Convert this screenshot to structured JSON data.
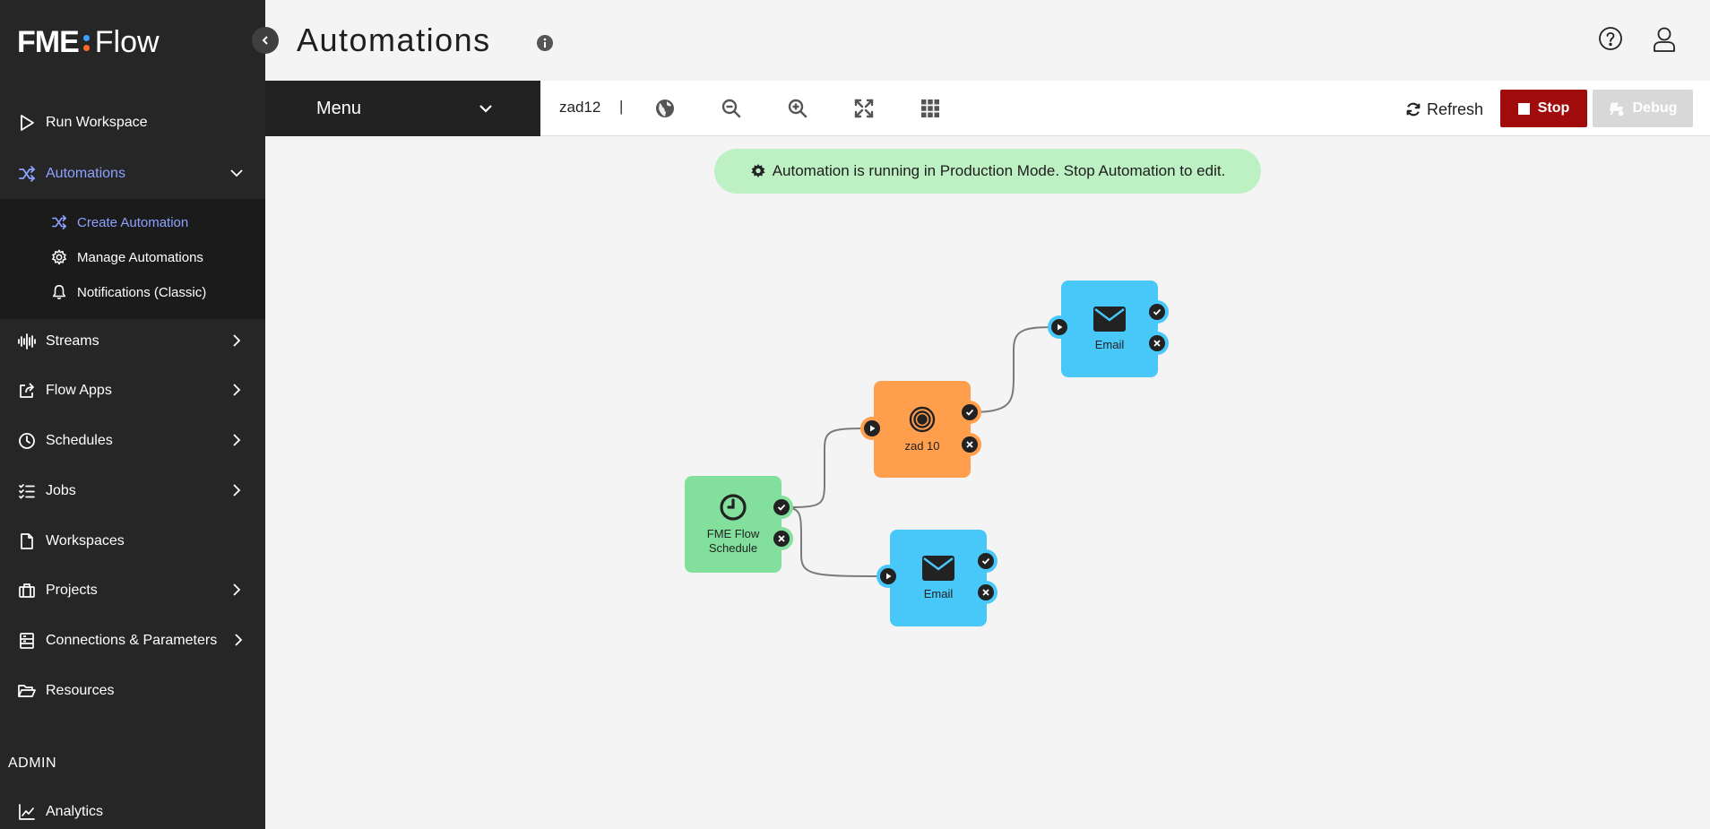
{
  "app": {
    "logo_main": "FME",
    "logo_sub": "Flow",
    "logo_dot_colors": [
      "#3aa0ff",
      "#ff6a2a"
    ]
  },
  "sidebar": {
    "items": [
      {
        "label": "Run Workspace",
        "icon": "play-outline-icon"
      },
      {
        "label": "Automations",
        "icon": "shuffle-icon",
        "active": true,
        "expanded": true
      },
      {
        "label": "Streams",
        "icon": "waveform-icon"
      },
      {
        "label": "Flow Apps",
        "icon": "share-icon"
      },
      {
        "label": "Schedules",
        "icon": "clock-icon"
      },
      {
        "label": "Jobs",
        "icon": "list-check-icon"
      },
      {
        "label": "Workspaces",
        "icon": "file-icon"
      },
      {
        "label": "Projects",
        "icon": "briefcase-icon"
      },
      {
        "label": "Connections & Parameters",
        "icon": "database-icon"
      },
      {
        "label": "Resources",
        "icon": "folder-open-icon"
      }
    ],
    "submenu": [
      {
        "label": "Create Automation",
        "icon": "shuffle-icon",
        "active": true
      },
      {
        "label": "Manage Automations",
        "icon": "gear-icon"
      },
      {
        "label": "Notifications (Classic)",
        "icon": "bell-icon"
      }
    ],
    "admin_label": "ADMIN",
    "admin_items": [
      {
        "label": "Analytics",
        "icon": "line-chart-icon"
      }
    ]
  },
  "header": {
    "title": "Automations"
  },
  "toolbar": {
    "menu_label": "Menu",
    "workspace_name": "zad12",
    "separator": "|",
    "tools": [
      "globe-icon",
      "zoom-out-icon",
      "zoom-in-icon",
      "fit-screen-icon",
      "grid-icon"
    ],
    "refresh_label": "Refresh",
    "stop_label": "Stop",
    "debug_label": "Debug"
  },
  "banner": {
    "text": "Automation is running in Production Mode. Stop Automation to edit."
  },
  "nodes": {
    "schedule": {
      "label_line1": "FME Flow",
      "label_line2": "Schedule",
      "color": "#82e09c"
    },
    "workspace": {
      "label": "zad 10",
      "color": "#ff9f4d"
    },
    "email_top": {
      "label": "Email",
      "color": "#48c8f8"
    },
    "email_bottom": {
      "label": "Email",
      "color": "#48c8f8"
    }
  },
  "colors": {
    "accent": "#8ea2ff",
    "stop": "#a00c0c",
    "banner_bg": "#bdf0c3",
    "sidebar_bg": "#262626"
  }
}
